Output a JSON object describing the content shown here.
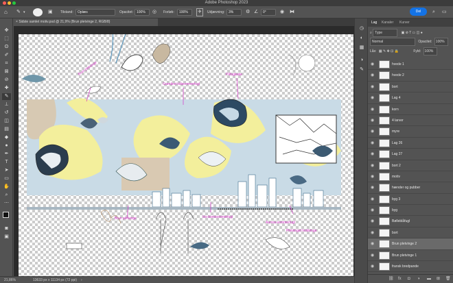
{
  "window": {
    "title": "Adobe Photoshop 2023"
  },
  "options": {
    "mode_label": "Tilstand:",
    "mode_value": "Oplæs",
    "opacity_label": "Opacitet:",
    "opacity_value": "100%",
    "flow_label": "Forløb:",
    "flow_value": "100%",
    "smoothing_label": "Udjævning:",
    "smoothing_value": "3%",
    "angle_value": "0°",
    "share_label": "Del"
  },
  "document": {
    "tab_title": "Sidste samlet motiv.psd @ 21,9% (Brun pletvinge 2, RGB/8)"
  },
  "status": {
    "zoom": "21,86%",
    "doc_size": "13633 px x 11134 px (72 ppi)"
  },
  "annotations": {
    "a1": "Brun pletvinge",
    "a2": "Grønåret kålsommerfugl",
    "a3": "Påfugleøje",
    "a4": "Brun pletvinge",
    "a5": "Iris-bomsommerfugl",
    "a6": "Aurora-sommerfugl",
    "a7": "Pletvinget hvidvinge"
  },
  "panel": {
    "tabs": [
      "Lag",
      "Kanaler",
      "Kurver"
    ],
    "filter_label": "Type",
    "blend_mode": "Normal",
    "opacity_label": "Opacitet:",
    "opacity_value": "100%",
    "lock_label": "Lås:",
    "fill_label": "Fyld:",
    "fill_value": "100%"
  },
  "layers": [
    "hvede 1",
    "hvede 2",
    "bort",
    "Lag 4",
    "korn",
    "4 larver",
    "myre",
    "Lag 26",
    "Lag 27",
    "bort 2",
    "motiv",
    "hænder og pubber",
    "byg 3",
    "byg",
    "Bølleblåfugl",
    "bort",
    "Brun pletvinge 2",
    "Brun pletvinge 1",
    "fransk bredpande"
  ],
  "selected_layer": "Brun pletvinge 2",
  "colors": {
    "accent": "#1473e6",
    "annotation": "#d633c8",
    "highlight": "#f3ef9c",
    "sky": "#c9dbe6"
  }
}
